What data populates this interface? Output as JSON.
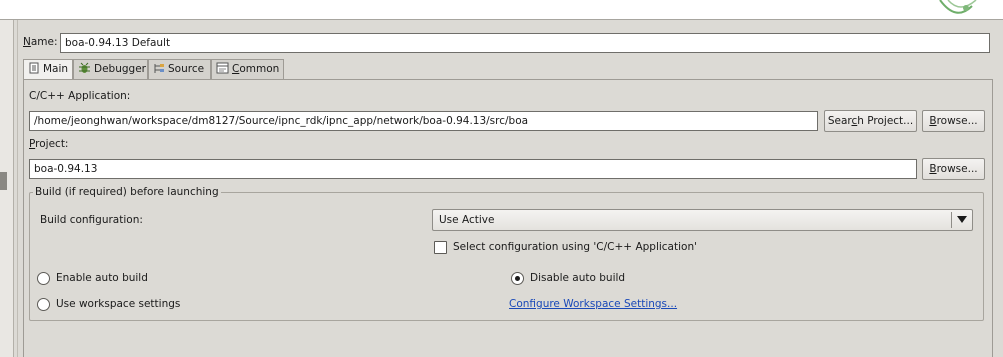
{
  "name_field": {
    "label_mnemonic": "N",
    "label_rest": "ame:",
    "value": "boa-0.94.13 Default"
  },
  "tabs": [
    {
      "label": "Main",
      "icon": "main-tab-icon",
      "active": true
    },
    {
      "label": "Debugger",
      "icon": "debugger-bug-icon",
      "active": false
    },
    {
      "label": "Source",
      "icon": "source-lookup-icon",
      "active": false
    },
    {
      "label_mnemonic": "C",
      "label_rest": "ommon",
      "icon": "common-icon",
      "active": false
    }
  ],
  "main": {
    "application": {
      "label": "C/C++ Application:",
      "value": "/home/jeonghwan/workspace/dm8127/Source/ipnc_rdk/ipnc_app/network/boa-0.94.13/src/boa",
      "search_button": {
        "pre": "Sear",
        "mnemonic": "c",
        "post": "h Project..."
      },
      "browse_button": {
        "pre": "",
        "mnemonic": "B",
        "post": "rowse..."
      }
    },
    "project": {
      "label_mnemonic": "P",
      "label_rest": "roject:",
      "value": "boa-0.94.13",
      "browse_button": {
        "pre": "",
        "mnemonic": "B",
        "post": "rowse..."
      }
    },
    "build": {
      "group_title": "Build (if required) before launching",
      "config_label": "Build configuration:",
      "config_value": "Use Active",
      "select_config_label": "Select configuration using 'C/C++ Application'",
      "select_config_checked": false,
      "enable_auto_build": "Enable auto build",
      "disable_auto_build": "Disable auto build",
      "use_workspace_settings": "Use workspace settings",
      "configure_link": "Configure Workspace Settings...",
      "selected_option": "disable_auto_build"
    }
  },
  "colors": {
    "panel_bg": "#dcdad5",
    "link": "#1a49b8"
  }
}
